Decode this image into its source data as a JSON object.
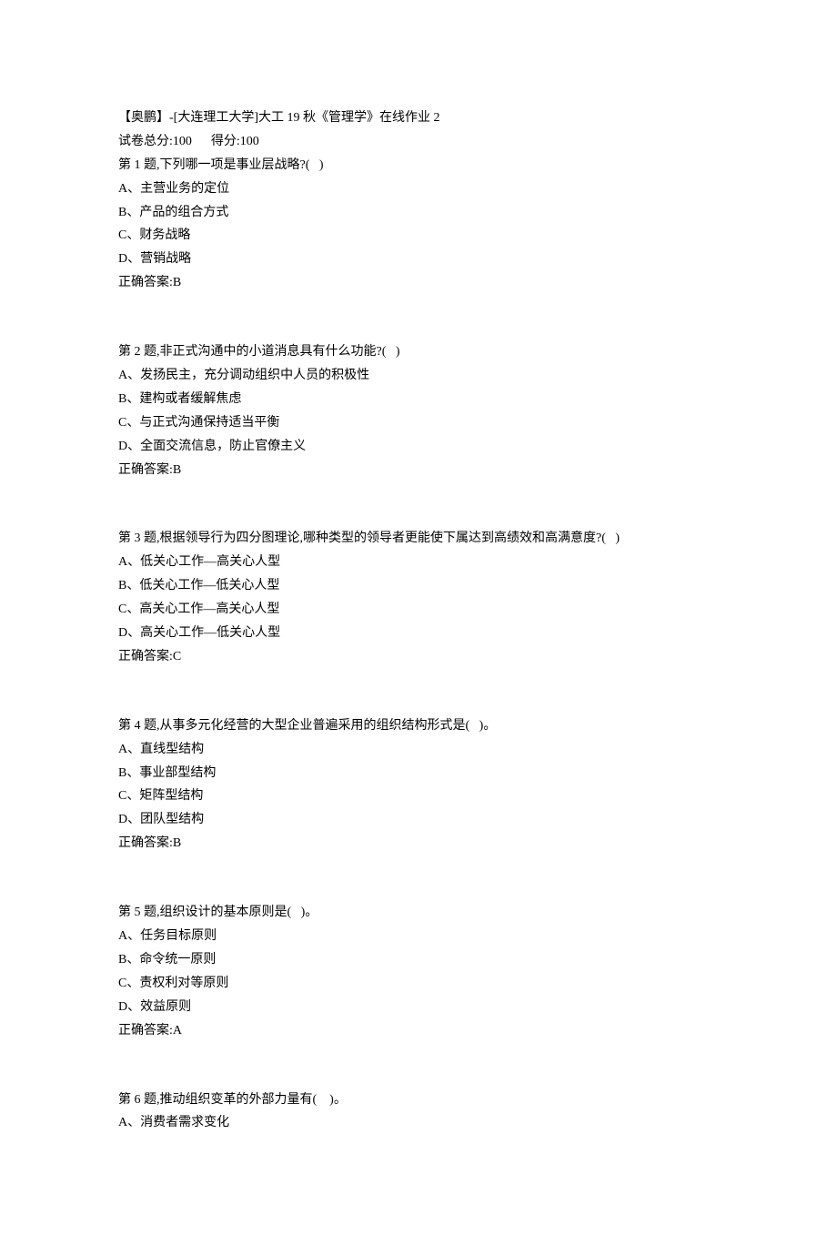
{
  "header": {
    "title": "【奥鹏】-[大连理工大学]大工 19 秋《管理学》在线作业 2",
    "score_line": "试卷总分:100      得分:100"
  },
  "questions": [
    {
      "stem": "第 1 题,下列哪一项是事业层战略?(   )",
      "options": [
        "A、主营业务的定位",
        "B、产品的组合方式",
        "C、财务战略",
        "D、营销战略"
      ],
      "answer": "正确答案:B"
    },
    {
      "stem": "第 2 题,非正式沟通中的小道消息具有什么功能?(   )",
      "options": [
        "A、发扬民主，充分调动组织中人员的积极性",
        "B、建构或者缓解焦虑",
        "C、与正式沟通保持适当平衡",
        "D、全面交流信息，防止官僚主义"
      ],
      "answer": "正确答案:B"
    },
    {
      "stem": "第 3 题,根据领导行为四分图理论,哪种类型的领导者更能使下属达到高绩效和高满意度?(   )",
      "options": [
        "A、低关心工作—高关心人型",
        "B、低关心工作—低关心人型",
        "C、高关心工作—高关心人型",
        "D、高关心工作—低关心人型"
      ],
      "answer": "正确答案:C"
    },
    {
      "stem": "第 4 题,从事多元化经营的大型企业普遍采用的组织结构形式是(   )。",
      "options": [
        "A、直线型结构",
        "B、事业部型结构",
        "C、矩阵型结构",
        "D、团队型结构"
      ],
      "answer": "正确答案:B"
    },
    {
      "stem": "第 5 题,组织设计的基本原则是(   )。",
      "options": [
        "A、任务目标原则",
        "B、命令统一原则",
        "C、责权利对等原则",
        "D、效益原则"
      ],
      "answer": "正确答案:A"
    },
    {
      "stem": "第 6 题,推动组织变革的外部力量有(    )。",
      "options": [
        "A、消费者需求变化"
      ],
      "answer": ""
    }
  ]
}
